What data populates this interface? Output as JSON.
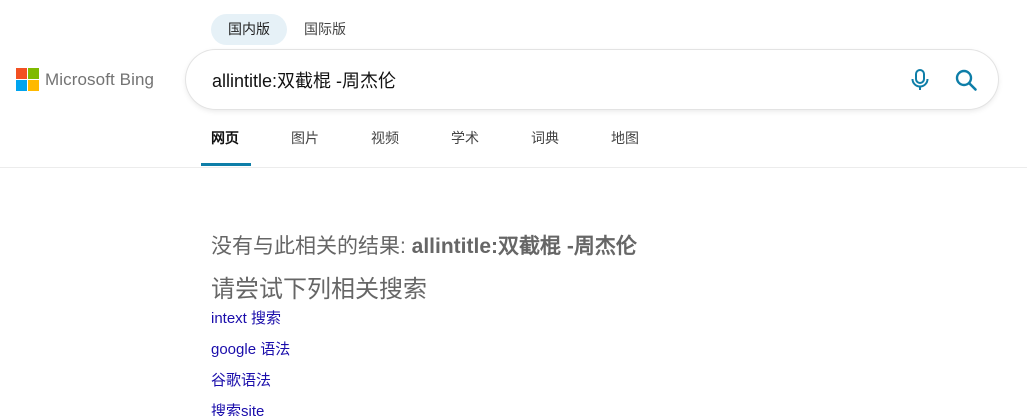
{
  "region_tabs": [
    {
      "label": "国内版",
      "active": true
    },
    {
      "label": "国际版",
      "active": false
    }
  ],
  "logo": {
    "text": "Microsoft Bing",
    "colors": [
      "#f25022",
      "#7fba00",
      "#00a4ef",
      "#ffb900"
    ]
  },
  "search": {
    "value": "allintitle:双截棍 -周杰伦",
    "icons": [
      "microphone-icon",
      "search-icon"
    ]
  },
  "nav": {
    "items": [
      {
        "label": "网页",
        "active": true
      },
      {
        "label": "图片",
        "active": false
      },
      {
        "label": "视频",
        "active": false
      },
      {
        "label": "学术",
        "active": false
      },
      {
        "label": "词典",
        "active": false
      },
      {
        "label": "地图",
        "active": false
      }
    ]
  },
  "results": {
    "no_results_prefix": "没有与此相关的结果: ",
    "no_results_query": "allintitle:双截棍 -周杰伦",
    "try_title": "请尝试下列相关搜索",
    "related": [
      "intext 搜索",
      "google 语法",
      "谷歌语法",
      "搜索site"
    ]
  },
  "colors": {
    "accent": "#0e7ea8",
    "link": "#1a0dab",
    "region_active_bg": "#e6f1f7"
  }
}
